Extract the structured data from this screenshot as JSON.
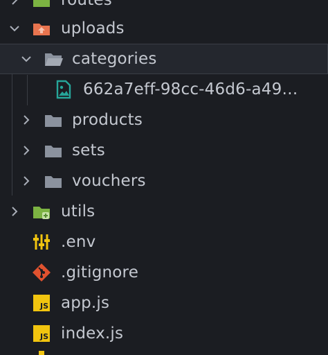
{
  "explorer": {
    "items": [
      {
        "label": "routes",
        "icon": "folder-green-icon"
      },
      {
        "label": "uploads",
        "icon": "folder-upload-orange-icon"
      },
      {
        "label": "categories",
        "icon": "folder-open-icon"
      },
      {
        "label": "662a7eff-98cc-46d6-a49…",
        "icon": "image-file-icon"
      },
      {
        "label": "products",
        "icon": "folder-icon"
      },
      {
        "label": "sets",
        "icon": "folder-icon"
      },
      {
        "label": "vouchers",
        "icon": "folder-icon"
      },
      {
        "label": "utils",
        "icon": "folder-utils-green-icon"
      },
      {
        "label": ".env",
        "icon": "env-settings-icon"
      },
      {
        "label": ".gitignore",
        "icon": "git-icon"
      },
      {
        "label": "app.js",
        "icon": "javascript-file-icon"
      },
      {
        "label": "index.js",
        "icon": "javascript-file-icon"
      }
    ],
    "js_badge": "JS",
    "colors": {
      "background": "#1b1d22",
      "selected_row": "#24272e",
      "text": "#c4c8d0",
      "folder_gray": "#8b929e",
      "folder_green": "#7cb342",
      "folder_orange": "#e8744f",
      "image_teal": "#26a69a",
      "git_red": "#e0522f",
      "js_yellow": "#f1c40f"
    }
  }
}
